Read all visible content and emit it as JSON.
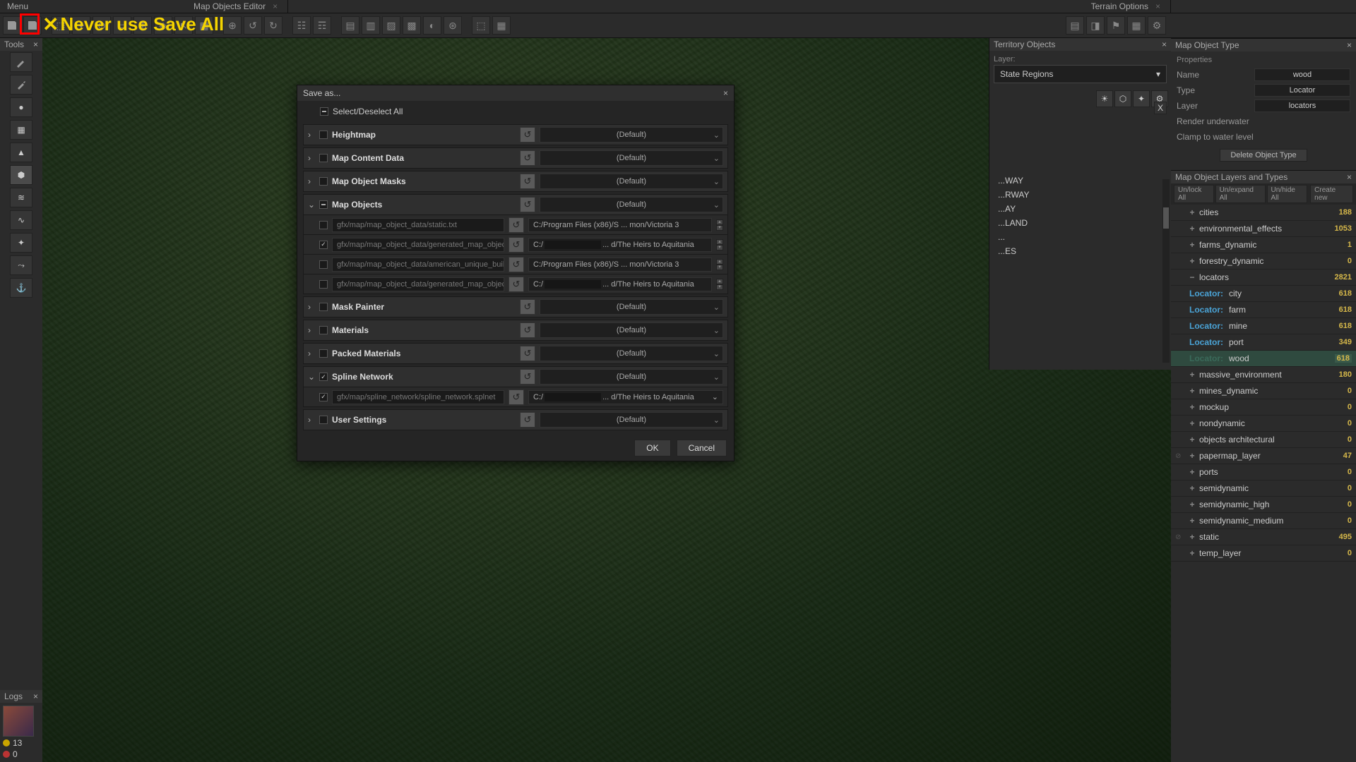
{
  "annotation": {
    "warning": "Never use Save All"
  },
  "menubar": {
    "menu": "Menu",
    "tabs": [
      "Map Objects Editor",
      "Terrain Options"
    ]
  },
  "left_panel": {
    "tools_title": "Tools",
    "logs_title": "Logs",
    "log_warn": "13",
    "log_err": "0"
  },
  "territory": {
    "title": "Territory Objects",
    "layer_label": "Layer:",
    "layer_value": "State Regions",
    "items": [
      "...WAY",
      "...RWAY",
      "...AY",
      "...LAND",
      "...",
      "...ES"
    ],
    "close": "X"
  },
  "map_type": {
    "title": "Map Object Type",
    "props_label": "Properties",
    "rows": {
      "name": {
        "label": "Name",
        "value": "wood"
      },
      "type": {
        "label": "Type",
        "value": "Locator"
      },
      "layer": {
        "label": "Layer",
        "value": "locators"
      },
      "render": {
        "label": "Render underwater"
      },
      "clamp": {
        "label": "Clamp to water level"
      }
    },
    "delete": "Delete Object Type"
  },
  "layers_panel": {
    "title": "Map Object Layers and Types",
    "toolbar": {
      "unlock": "Un/lock All",
      "unexpand": "Un/expand All",
      "unhide": "Un/hide All",
      "create": "Create new"
    },
    "items": [
      {
        "exp": "+",
        "name": "cities",
        "count": "188"
      },
      {
        "exp": "+",
        "name": "environmental_effects",
        "count": "1053"
      },
      {
        "exp": "+",
        "name": "farms_dynamic",
        "count": "1"
      },
      {
        "exp": "+",
        "name": "forestry_dynamic",
        "count": "0"
      },
      {
        "exp": "−",
        "name": "locators",
        "count": "2821",
        "children": [
          {
            "loc": "Locator:",
            "name": "city",
            "count": "618"
          },
          {
            "loc": "Locator:",
            "name": "farm",
            "count": "618"
          },
          {
            "loc": "Locator:",
            "name": "mine",
            "count": "618"
          },
          {
            "loc": "Locator:",
            "name": "port",
            "count": "349"
          },
          {
            "loc": "Locator:",
            "name": "wood",
            "count": "618",
            "selected": true
          }
        ]
      },
      {
        "exp": "+",
        "name": "massive_environment",
        "count": "180"
      },
      {
        "exp": "+",
        "name": "mines_dynamic",
        "count": "0"
      },
      {
        "exp": "+",
        "name": "mockup",
        "count": "0"
      },
      {
        "exp": "+",
        "name": "nondynamic",
        "count": "0"
      },
      {
        "exp": "+",
        "name": "objects architectural",
        "count": "0"
      },
      {
        "exp": "+",
        "name": "papermap_layer",
        "count": "47",
        "hidden": true
      },
      {
        "exp": "+",
        "name": "ports",
        "count": "0"
      },
      {
        "exp": "+",
        "name": "semidynamic",
        "count": "0"
      },
      {
        "exp": "+",
        "name": "semidynamic_high",
        "count": "0"
      },
      {
        "exp": "+",
        "name": "semidynamic_medium",
        "count": "0"
      },
      {
        "exp": "+",
        "name": "static",
        "count": "495",
        "hidden": true
      },
      {
        "exp": "+",
        "name": "temp_layer",
        "count": "0"
      }
    ]
  },
  "dialog": {
    "title": "Save as...",
    "select_all": "Select/Deselect All",
    "default": "(Default)",
    "reset_glyph": "↺",
    "sections": [
      {
        "name": "Heightmap",
        "chev": "›",
        "checked": false
      },
      {
        "name": "Map Content Data",
        "chev": "›",
        "checked": false
      },
      {
        "name": "Map Object Masks",
        "chev": "›",
        "checked": false
      },
      {
        "name": "Map Objects",
        "chev": "⌄",
        "checked": "tri",
        "rows": [
          {
            "checked": false,
            "file": "gfx/map/map_object_data/static.txt",
            "dest": "C:/Program Files (x86)/S ... mon/Victoria 3"
          },
          {
            "checked": true,
            "file": "gfx/map/map_object_data/generated_map_object_loc",
            "dest_pre": "C:/",
            "dest_post": "... d/The Heirs to Aquitania"
          },
          {
            "checked": false,
            "file": "gfx/map/map_object_data/american_unique_building",
            "dest": "C:/Program Files (x86)/S ... mon/Victoria 3"
          },
          {
            "checked": false,
            "file": "gfx/map/map_object_data/generated_map_object_loc",
            "dest_pre": "C:/",
            "dest_post": "... d/The Heirs to Aquitania"
          }
        ]
      },
      {
        "name": "Mask Painter",
        "chev": "›",
        "checked": false
      },
      {
        "name": "Materials",
        "chev": "›",
        "checked": false
      },
      {
        "name": "Packed Materials",
        "chev": "›",
        "checked": false
      },
      {
        "name": "Spline Network",
        "chev": "⌄",
        "checked": true,
        "rows": [
          {
            "checked": true,
            "file": "gfx/map/spline_network/spline_network.splnet",
            "dest_pre": "C:/",
            "dest_post": "... d/The Heirs to Aquitania",
            "dd": true
          }
        ]
      },
      {
        "name": "User Settings",
        "chev": "›",
        "checked": false
      }
    ],
    "ok": "OK",
    "cancel": "Cancel"
  }
}
